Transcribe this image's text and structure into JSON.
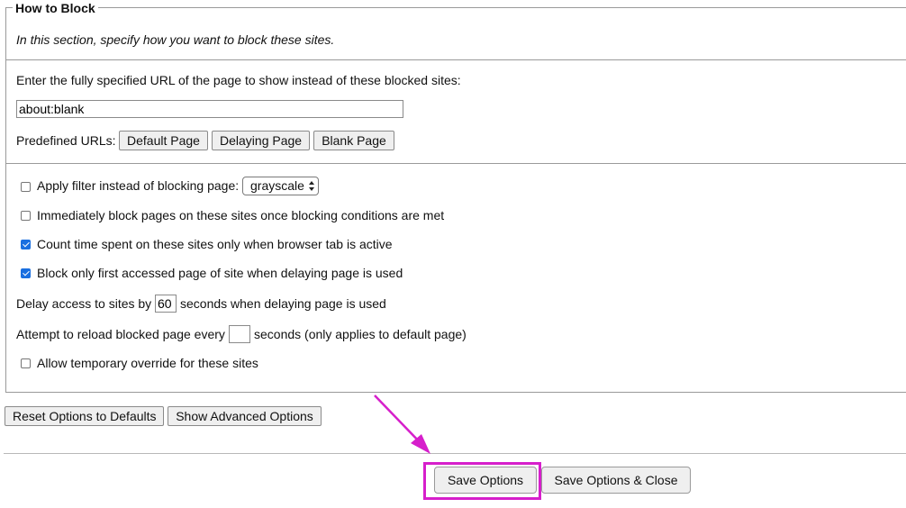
{
  "section": {
    "legend": "How to Block",
    "description": "In this section, specify how you want to block these sites.",
    "url_prompt": "Enter the fully specified URL of the page to show instead of these blocked sites:",
    "url_value": "about:blank",
    "predefined_label": "Predefined URLs:",
    "predefined_buttons": {
      "default": "Default Page",
      "delaying": "Delaying Page",
      "blank": "Blank Page"
    },
    "filter": {
      "label": "Apply filter instead of blocking page:",
      "checked": false,
      "selected": "grayscale"
    },
    "immediate": {
      "label": "Immediately block pages on these sites once blocking conditions are met",
      "checked": false
    },
    "active_tab": {
      "label": "Count time spent on these sites only when browser tab is active",
      "checked": true
    },
    "first_page": {
      "label": "Block only first accessed page of site when delaying page is used",
      "checked": true
    },
    "delay": {
      "prefix": "Delay access to sites by",
      "value": "60",
      "suffix": "seconds when delaying page is used"
    },
    "reload": {
      "prefix": "Attempt to reload blocked page every",
      "value": "",
      "suffix": "seconds (only applies to default page)"
    },
    "override": {
      "label": "Allow temporary override for these sites",
      "checked": false
    }
  },
  "actions": {
    "reset": "Reset Options to Defaults",
    "advanced": "Show Advanced Options",
    "save": "Save Options",
    "save_close": "Save Options & Close"
  },
  "colors": {
    "annotation": "#d61fcb",
    "checkbox_checked": "#1a6fe0"
  }
}
